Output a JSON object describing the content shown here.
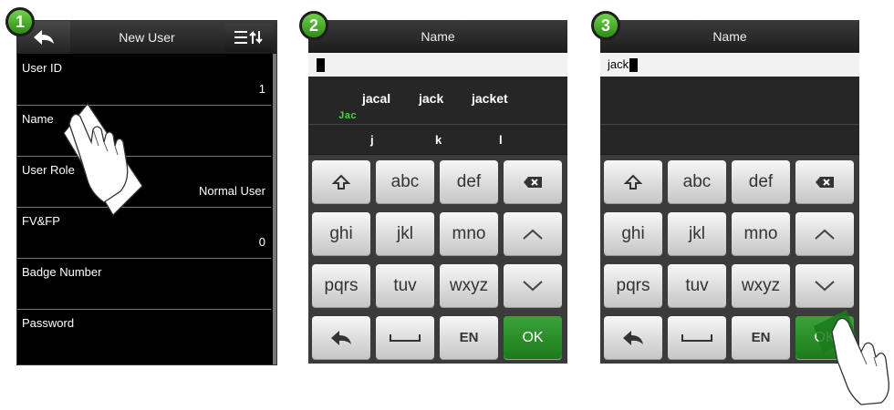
{
  "steps": [
    "1",
    "2",
    "3"
  ],
  "screen1": {
    "title": "New User",
    "fields": [
      {
        "label": "User ID",
        "value": "1"
      },
      {
        "label": "Name",
        "value": ""
      },
      {
        "label": "User Role",
        "value": "Normal User"
      },
      {
        "label": "FV&FP",
        "value": "0"
      },
      {
        "label": "Badge Number",
        "value": ""
      },
      {
        "label": "Password",
        "value": ""
      }
    ]
  },
  "screen2": {
    "title": "Name",
    "input_value": "",
    "candidates": [
      "jacal",
      "jack",
      "jacket"
    ],
    "typed": "Jac",
    "letters": [
      "j",
      "k",
      "l"
    ]
  },
  "screen3": {
    "title": "Name",
    "input_value": "jack"
  },
  "keyboard": {
    "row1": [
      "abc",
      "def"
    ],
    "row2": [
      "ghi",
      "jkl",
      "mno"
    ],
    "row3": [
      "pqrs",
      "tuv",
      "wxyz"
    ],
    "lang": "EN",
    "ok": "OK"
  },
  "colors": {
    "ok_green": "#2a8f2a",
    "badge_green": "#4cb52e",
    "candidate_green": "#3cd93c"
  }
}
